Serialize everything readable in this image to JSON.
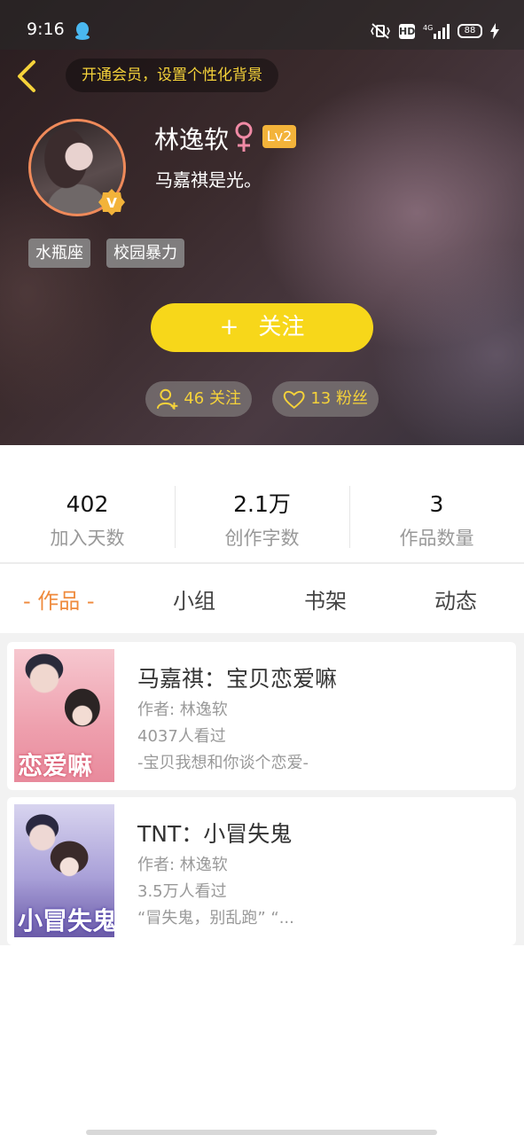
{
  "status_bar": {
    "time": "9:16",
    "network": "4G",
    "battery": "88"
  },
  "header": {
    "vip_banner": "开通会员，设置个性化背景",
    "user_name": "林逸软",
    "level": "Lv2",
    "bio": "马嘉祺是光。",
    "tags": [
      "水瓶座",
      "校园暴力"
    ],
    "follow_plus": "+",
    "follow_label": "关注",
    "following": "46 关注",
    "fans": "13 粉丝",
    "verified_badge_text": "V"
  },
  "stats": [
    {
      "value": "402",
      "label": "加入天数"
    },
    {
      "value": "2.1万",
      "label": "创作字数"
    },
    {
      "value": "3",
      "label": "作品数量"
    }
  ],
  "tabs": [
    {
      "label": "- 作品 -",
      "active": true
    },
    {
      "label": "小组",
      "active": false
    },
    {
      "label": "书架",
      "active": false
    },
    {
      "label": "动态",
      "active": false
    }
  ],
  "works": [
    {
      "title": "马嘉祺：宝贝恋爱嘛",
      "author": "作者: 林逸软",
      "views": "4037人看过",
      "excerpt": "-宝贝我想和你谈个恋爱-",
      "cover_text": "恋爱嘛"
    },
    {
      "title": "TNT：小冒失鬼",
      "author": "作者: 林逸软",
      "views": "3.5万人看过",
      "excerpt": "“冒失鬼，别乱跑” “...",
      "cover_text": "小冒失鬼"
    }
  ],
  "colors": {
    "accent_yellow": "#f7d71a",
    "accent_orange": "#ef8a3c",
    "level_badge": "#f3b33a"
  },
  "icons": {
    "back": "chevron-left-icon",
    "qq": "qq-icon",
    "female": "female-icon",
    "following": "user-add-icon",
    "fans": "heart-icon",
    "verified": "verified-badge-icon"
  }
}
